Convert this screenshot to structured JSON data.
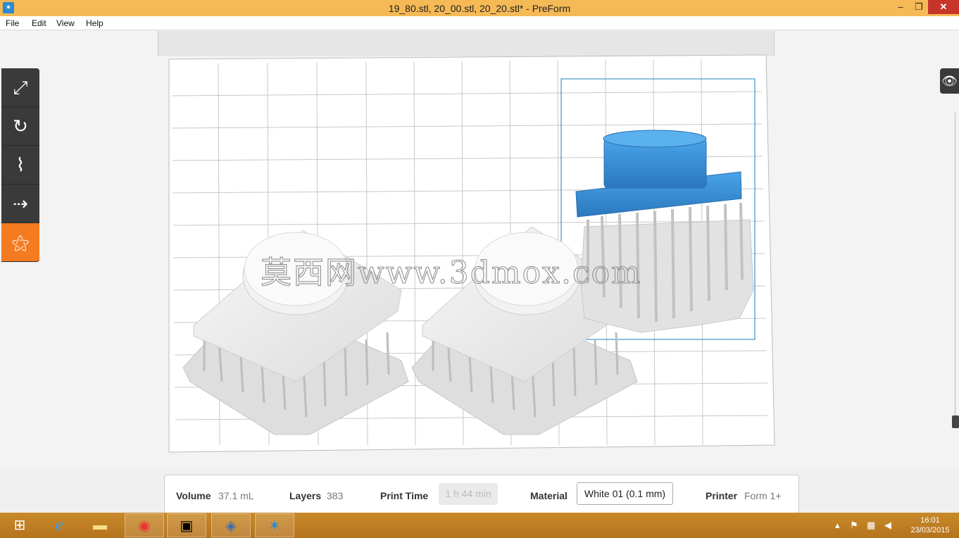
{
  "window": {
    "title": "19_80.stl, 20_00.stl, 20_20.stl* - PreForm",
    "minimize": "–",
    "maximize": "❐",
    "close": "✕"
  },
  "menu": [
    "File",
    "Edit",
    "View",
    "Help"
  ],
  "tools": [
    {
      "name": "scale-icon",
      "glyph": "⤢"
    },
    {
      "name": "rotate-icon",
      "glyph": "↻"
    },
    {
      "name": "supports-icon",
      "glyph": "⌇"
    },
    {
      "name": "layout-icon",
      "glyph": "⇢"
    },
    {
      "name": "formlabs-logo-icon",
      "glyph": "⚝"
    }
  ],
  "watermark": "莫西网www.3dmox.com",
  "status": {
    "volume_label": "Volume",
    "volume_value": "37.1 mL",
    "layers_label": "Layers",
    "layers_value": "383",
    "print_time_label": "Print Time",
    "print_time_value": "1 h 44 min",
    "material_label": "Material",
    "material_value": "White 01 (0.1 mm)",
    "printer_label": "Printer",
    "printer_value": "Form 1+"
  },
  "clock": {
    "time": "16:01",
    "date": "23/03/2015"
  },
  "colors": {
    "title_bar": "#f5b955",
    "accent": "#f47b20",
    "selected_model": "#3b8fd6",
    "model": "#e8e8e8"
  }
}
